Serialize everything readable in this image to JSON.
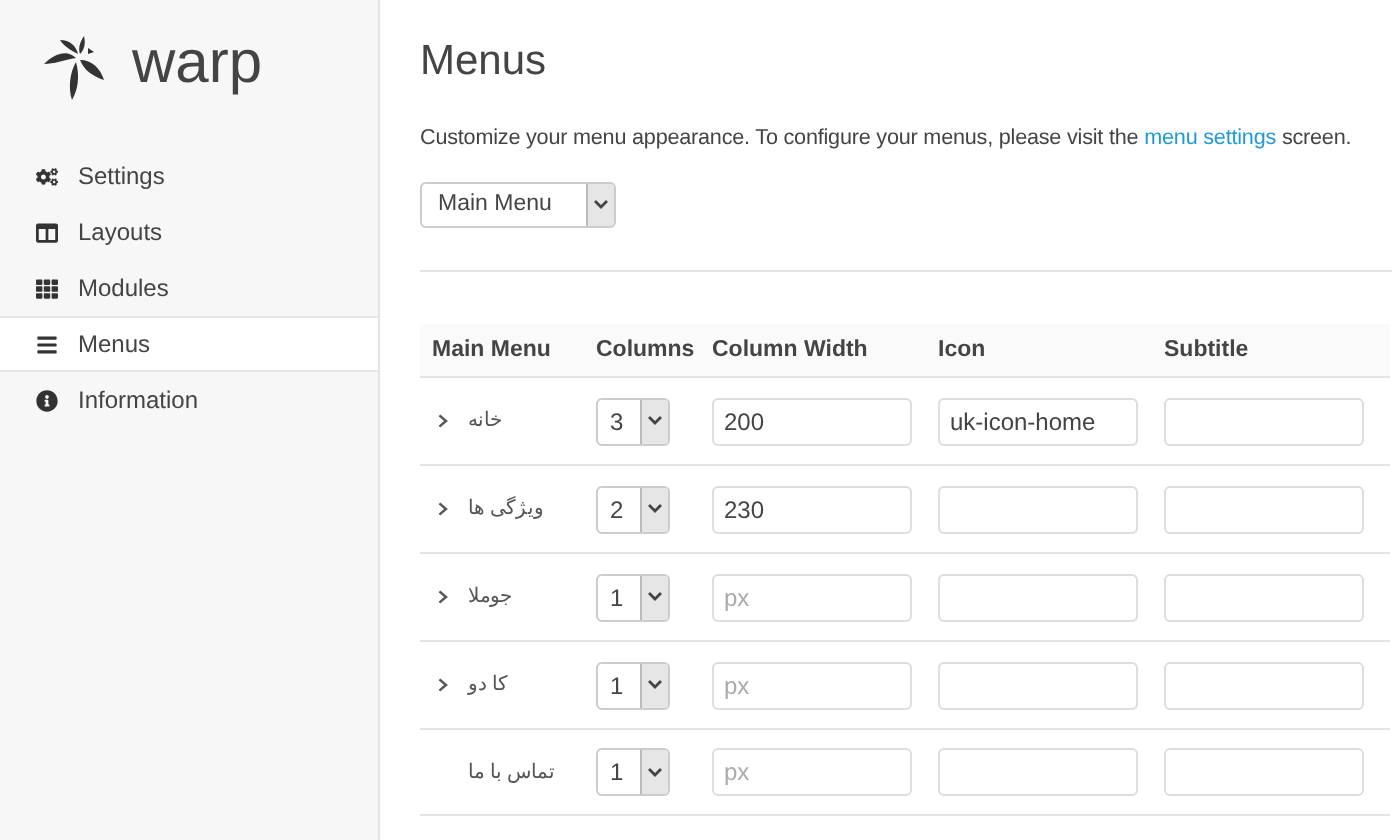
{
  "logo": {
    "text": "warp"
  },
  "sidebar": {
    "items": [
      {
        "label": "Settings",
        "selected": false
      },
      {
        "label": "Layouts",
        "selected": false
      },
      {
        "label": "Modules",
        "selected": false
      },
      {
        "label": "Menus",
        "selected": true
      },
      {
        "label": "Information",
        "selected": false
      }
    ]
  },
  "page": {
    "title": "Menus",
    "description": "Customize your menu appearance. To configure your menus, please visit the",
    "link": "menu settings",
    "description_end": "screen."
  },
  "menu_select": {
    "value": "Main Menu"
  },
  "table": {
    "columns": [
      "Main Menu",
      "Columns",
      "Column Width",
      "Icon",
      "Subtitle"
    ],
    "rows": [
      {
        "name": "خانه",
        "expandable": true,
        "columns": "3",
        "column_width": {
          "value": "200"
        },
        "icon": {
          "value": "uk-icon-home"
        }
      },
      {
        "name": "ویژگی ها",
        "expandable": true,
        "columns": "2",
        "column_width": {
          "value": "230"
        }
      },
      {
        "name": "جوملا",
        "expandable": true,
        "columns": "1",
        "column_width": {
          "placeholder": "px"
        }
      },
      {
        "name": "کا دو",
        "expandable": true,
        "columns": "1",
        "column_width": {
          "placeholder": "px"
        }
      },
      {
        "name": "تماس با ما",
        "expandable": false,
        "columns": "1",
        "column_width": {
          "placeholder": "px"
        }
      }
    ]
  }
}
